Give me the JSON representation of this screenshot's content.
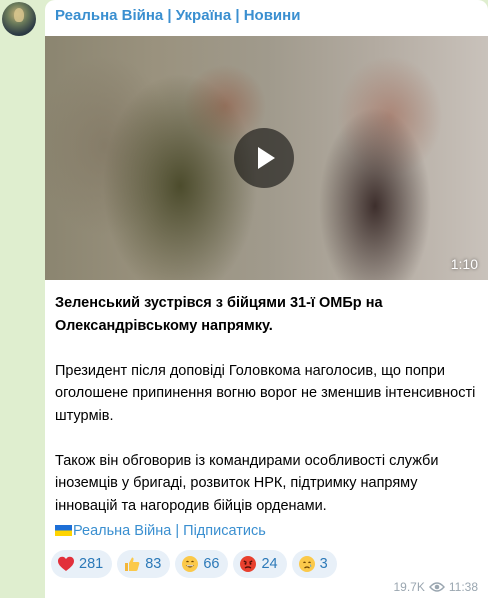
{
  "channel": {
    "name": "Реальна Війна | Україна | Новини"
  },
  "video": {
    "duration": "1:10"
  },
  "post": {
    "paragraphs": [
      "Зеленський зустрівся з бійцями 31-ї ОМБр на Олександрівському напрямку.",
      "Президент після доповіді Головкома наголосив, що попри оголошене припинення вогню ворог не зменшив інтенсивності штурмів.",
      "Також він обговорив із командирами особливості служби іноземців у бригаді, розвиток НРК, підтримку напряму інновацій та нагородив бійців орденами."
    ],
    "footer_link": "Реальна Війна | Підписатись"
  },
  "reactions": [
    {
      "icon": "heart",
      "count": "281"
    },
    {
      "icon": "thumbs-up",
      "count": "83"
    },
    {
      "icon": "grinning-face",
      "count": "66"
    },
    {
      "icon": "angry-face",
      "count": "24"
    },
    {
      "icon": "crying-face",
      "count": "3"
    }
  ],
  "meta": {
    "views": "19.7K",
    "time": "11:38"
  },
  "colors": {
    "background": "#dfeecf",
    "accent": "#3a8fd0",
    "reaction_bg": "#e8f0f8"
  }
}
